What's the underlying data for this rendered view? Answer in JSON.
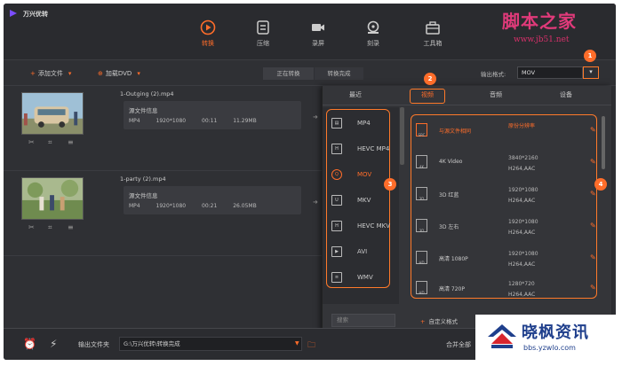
{
  "app": {
    "title": "万兴优转"
  },
  "nav": {
    "tabs": [
      {
        "label": "转换",
        "icon": "convert-icon",
        "active": true
      },
      {
        "label": "压缩",
        "icon": "compress-icon"
      },
      {
        "label": "录屏",
        "icon": "record-icon"
      },
      {
        "label": "刻录",
        "icon": "burn-icon"
      },
      {
        "label": "工具箱",
        "icon": "toolbox-icon"
      }
    ]
  },
  "watermark_top": {
    "text": "脚本之家",
    "url": "www.jb51.net"
  },
  "toolbar": {
    "add_file": "添加文件",
    "load_dvd": "加载DVD",
    "seg_converting": "正在转换",
    "seg_done": "转换完成",
    "output_format_label": "输出格式:",
    "output_format_value": "MOV"
  },
  "badges": [
    "1",
    "2",
    "3",
    "4"
  ],
  "files": [
    {
      "name": "1-Outging (2).mp4",
      "source_label": "源文件信息",
      "format": "MP4",
      "resolution": "1920*1080",
      "duration": "00:11",
      "size": "11.29MB"
    },
    {
      "name": "1-party (2).mp4",
      "source_label": "源文件信息",
      "format": "MP4",
      "resolution": "1920*1080",
      "duration": "00:21",
      "size": "26.05MB"
    }
  ],
  "format_panel": {
    "tabs": [
      "最近",
      "视频",
      "音频",
      "设备"
    ],
    "active_tab": "视频",
    "formats": [
      {
        "label": "MP4",
        "icon": "film-icon"
      },
      {
        "label": "HEVC MP4",
        "icon": "hevc-icon"
      },
      {
        "label": "MOV",
        "icon": "mov-icon",
        "active": true
      },
      {
        "label": "MKV",
        "icon": "mkv-icon"
      },
      {
        "label": "HEVC MKV",
        "icon": "hevc-mkv-icon"
      },
      {
        "label": "AVI",
        "icon": "avi-icon"
      },
      {
        "label": "WMV",
        "icon": "wmv-icon"
      }
    ],
    "qualities": [
      {
        "name": "与源文件相同",
        "res1": "原份分辨率",
        "res2": "",
        "active": true
      },
      {
        "name": "4K Video",
        "res1": "3840*2160",
        "res2": "H264,AAC"
      },
      {
        "name": "3D 红蓝",
        "res1": "1920*1080",
        "res2": "H264,AAC"
      },
      {
        "name": "3D 左右",
        "res1": "1920*1080",
        "res2": "H264,AAC"
      },
      {
        "name": "高清 1080P",
        "res1": "1920*1080",
        "res2": "H264,AAC"
      },
      {
        "name": "高清 720P",
        "res1": "1280*720",
        "res2": "H264,AAC"
      }
    ],
    "search_placeholder": "搜索",
    "custom_label": "自定义格式"
  },
  "bottom": {
    "output_folder_label": "输出文件夹",
    "output_folder_value": "G:\\万兴优转\\转换完成",
    "merge_label": "合并全部"
  },
  "watermark_bottom": {
    "text": "晓枫资讯",
    "url": "bbs.yzwlo.com"
  },
  "colors": {
    "accent": "#ff6d2a",
    "background": "#2f3034"
  }
}
